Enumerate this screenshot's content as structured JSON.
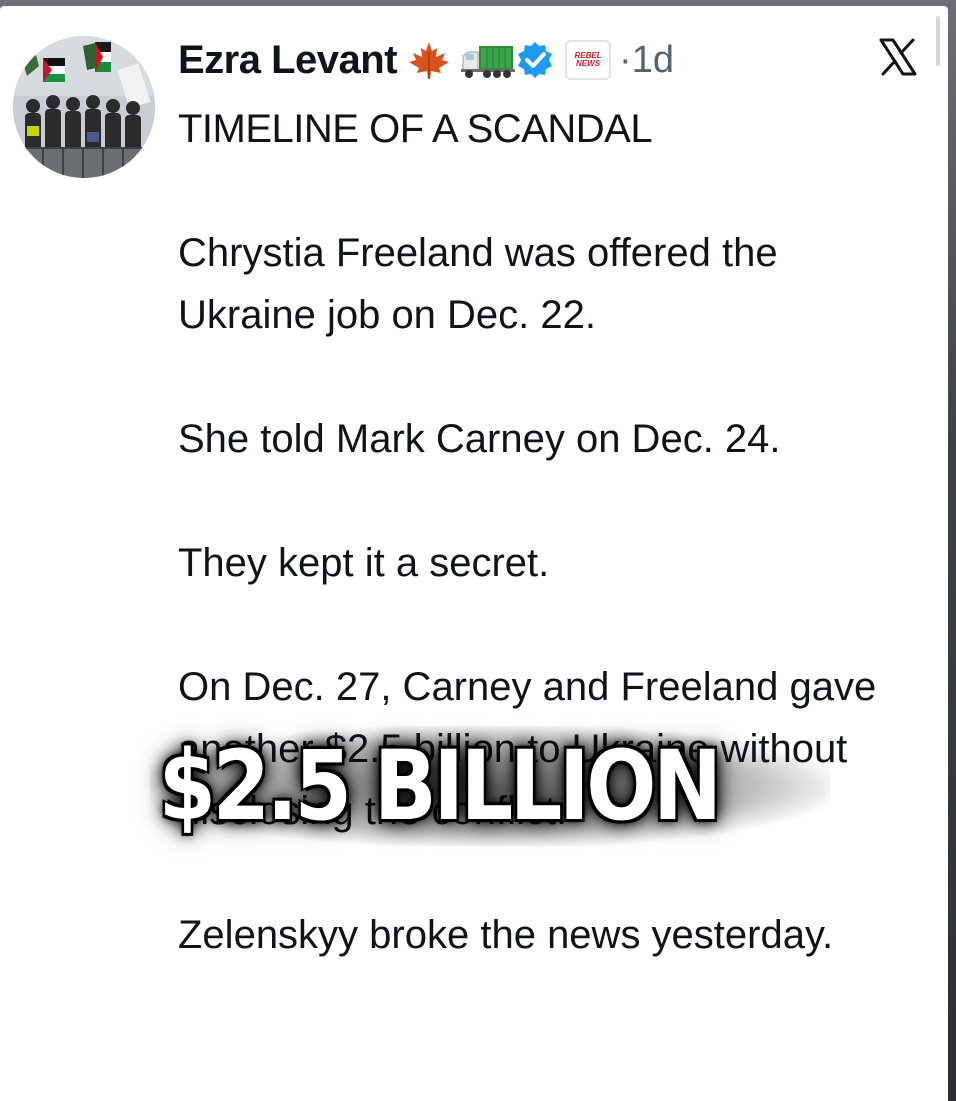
{
  "post": {
    "author": {
      "display_name": "Ezra Levant",
      "badges": [
        "maple-leaf-icon",
        "truck-icon",
        "verified-badge-icon",
        "affiliate-badge"
      ],
      "affiliate_label": "REBEL NEWS",
      "verified_color": "#1d9bf0"
    },
    "time_separator": "·",
    "timestamp": "1d",
    "platform_icon": "x-logo-icon",
    "title": "TIMELINE OF A SCANDAL",
    "paragraphs": [
      "Chrystia Freeland was offered the Ukraine job on Dec. 22.",
      "She told Mark Carney on Dec. 24.",
      "They kept it a secret.",
      "On Dec. 27, Carney and Freeland gave another $2.5 billion to Ukraine without disclosing the conflict.",
      "Zelenskyy broke the news yesterday."
    ]
  },
  "overlay": {
    "caption": "$2.5 BILLION"
  },
  "colors": {
    "text": "#0f1419",
    "muted": "#536471",
    "affiliate_red": "#c51f2e"
  }
}
